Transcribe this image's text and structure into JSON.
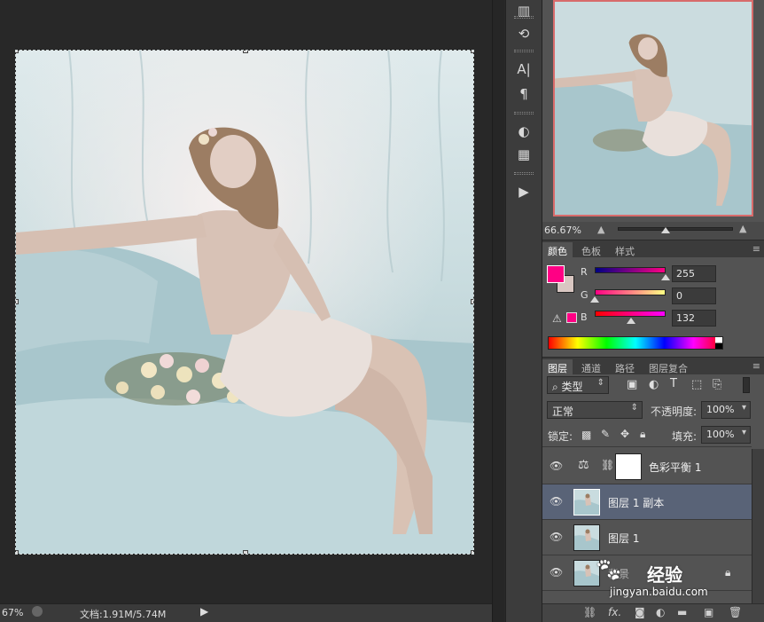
{
  "status": {
    "zoom": "67%",
    "doc_info": "文档:1.91M/5.74M"
  },
  "navigator": {
    "zoom": "66.67%"
  },
  "color_panel": {
    "tabs": [
      "颜色",
      "色板",
      "样式"
    ],
    "channels": [
      {
        "label": "R",
        "value": "255"
      },
      {
        "label": "G",
        "value": "0"
      },
      {
        "label": "B",
        "value": "132"
      }
    ],
    "foreground": "#ff0084",
    "background": "#d9c7c2"
  },
  "layers_panel": {
    "tabs": [
      "图层",
      "通道",
      "路径",
      "图层复合"
    ],
    "filter_type": "类型",
    "blend_mode": "正常",
    "opacity_label": "不透明度:",
    "opacity_value": "100%",
    "lock_label": "锁定:",
    "fill_label": "填充:",
    "fill_value": "100%",
    "layers": [
      {
        "name": "色彩平衡 1"
      },
      {
        "name": "图层 1 副本"
      },
      {
        "name": "图层 1"
      },
      {
        "name": "背景"
      }
    ]
  },
  "watermark": {
    "brand": "经验",
    "url": "jingyan.baidu.com"
  },
  "colors": {
    "selected_layer": "#596377",
    "nav_frame": "#d86b6b"
  }
}
